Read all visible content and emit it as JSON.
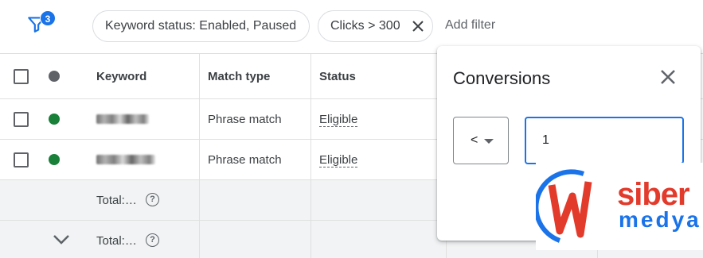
{
  "filters": {
    "active_count": "3",
    "chips": [
      {
        "label": "Keyword status: Enabled, Paused"
      },
      {
        "label": "Clicks > 300"
      }
    ],
    "add_filter_label": "Add filter"
  },
  "table": {
    "headers": {
      "keyword": "Keyword",
      "match_type": "Match type",
      "status": "Status"
    },
    "rows": [
      {
        "match_type": "Phrase match",
        "status": "Eligible",
        "status_color": "#188038"
      },
      {
        "match_type": "Phrase match",
        "status": "Eligible",
        "status_color": "#188038"
      }
    ],
    "totals": [
      {
        "label": "Total:…"
      },
      {
        "label": "Total:…"
      }
    ]
  },
  "conversions_popup": {
    "title": "Conversions",
    "operator": "<",
    "value": "1"
  },
  "watermark": {
    "word1": "siber",
    "word2": "medya"
  },
  "colors": {
    "accent": "#1a73e8",
    "enabled_green": "#188038"
  }
}
